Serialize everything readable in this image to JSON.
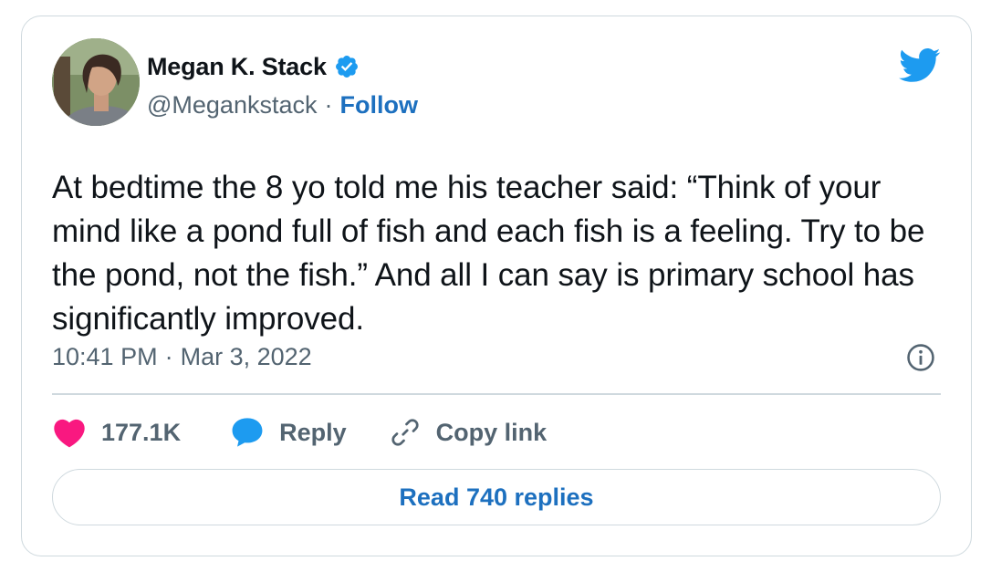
{
  "author": {
    "display_name": "Megan K. Stack",
    "handle": "@Megankstack",
    "separator": "·",
    "follow_label": "Follow"
  },
  "tweet": {
    "text": "At bedtime the 8 yo told me his teacher said: “Think of your mind like a pond full of fish and each fish is a feeling. Try to be the pond, not the fish.” And all I can say is primary school has significantly improved.",
    "time": "10:41 PM",
    "date": "Mar 3, 2022"
  },
  "actions": {
    "like_count": "177.1K",
    "reply_label": "Reply",
    "copy_link_label": "Copy link"
  },
  "footer": {
    "read_replies_label": "Read 740 replies"
  },
  "icons": {
    "brand": "twitter-bird-icon",
    "verified": "verified-badge-icon",
    "info": "info-icon",
    "like": "heart-icon",
    "reply": "speech-bubble-icon",
    "copy_link": "link-icon"
  },
  "colors": {
    "twitter_blue": "#1d9bf0",
    "link_blue": "#1d70bf",
    "like_pink": "#f91880",
    "secondary_text": "#536471",
    "border": "#cfd9de"
  }
}
